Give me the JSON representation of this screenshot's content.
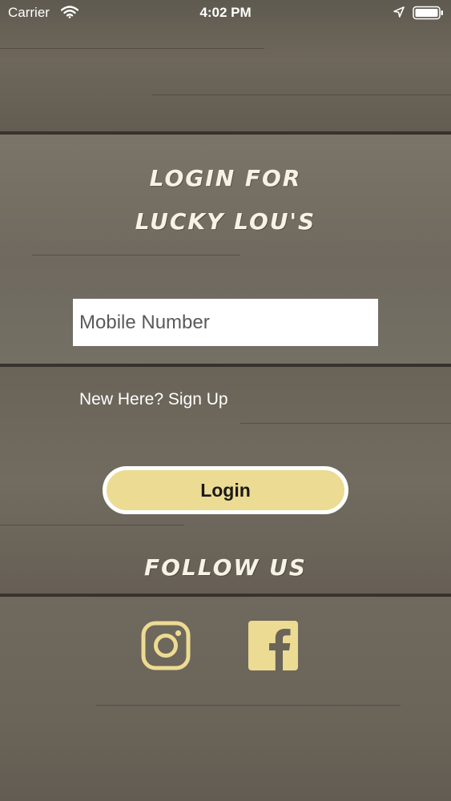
{
  "status_bar": {
    "carrier": "Carrier",
    "time": "4:02 PM"
  },
  "title": {
    "line1": "LOGIN FOR",
    "line2": "LUCKY LOU'S"
  },
  "login_form": {
    "mobile_placeholder": "Mobile Number",
    "mobile_value": "",
    "signup_link": "New Here? Sign Up",
    "login_button": "Login"
  },
  "social": {
    "heading": "FOLLOW US",
    "icons": [
      "instagram-icon",
      "facebook-icon"
    ]
  },
  "colors": {
    "accent": "#ecdb92",
    "button_border": "#ffffff",
    "heading_text": "#f6f2e6"
  }
}
